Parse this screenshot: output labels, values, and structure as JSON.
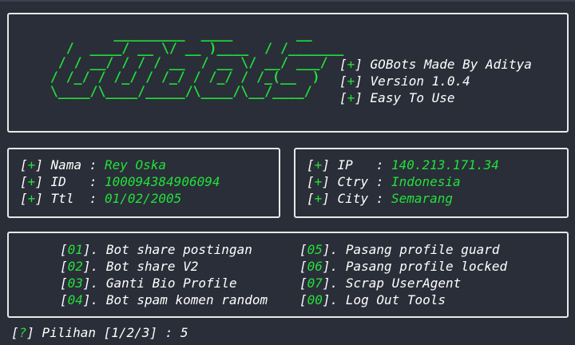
{
  "banner": {
    "ascii_logo": [
      "          _________  ____        __",
      "    /  ____/ __ \\/ __ )____  / /_______",
      "   / / __/ / / / __  / __ \\/ __/ ___/",
      "  / /_/ / /_/ / /_/ / /_/ / /_(__  )",
      "  \\____/\\____/_____/\\____/\\__/____/"
    ],
    "logo_alt": "GOBots",
    "info": [
      {
        "marker": "+",
        "text": "GOBots Made By Aditya"
      },
      {
        "marker": "+",
        "text": "Version 1.0.4"
      },
      {
        "marker": "+",
        "text": "Easy To Use"
      }
    ]
  },
  "user": [
    {
      "marker": "+",
      "label": "Nama",
      "sep": " : ",
      "value": "Rey Oska"
    },
    {
      "marker": "+",
      "label": "ID  ",
      "sep": " : ",
      "value": "100094384906094"
    },
    {
      "marker": "+",
      "label": "Ttl ",
      "sep": " : ",
      "value": "01/02/2005"
    }
  ],
  "network": [
    {
      "marker": "+",
      "label": "IP  ",
      "sep": " : ",
      "value": "140.213.171.34"
    },
    {
      "marker": "+",
      "label": "Ctry",
      "sep": " : ",
      "value": "Indonesia"
    },
    {
      "marker": "+",
      "label": "City",
      "sep": " : ",
      "value": "Semarang"
    }
  ],
  "menu": {
    "left": [
      {
        "num": "01",
        "label": "Bot share postingan"
      },
      {
        "num": "02",
        "label": "Bot share V2"
      },
      {
        "num": "03",
        "label": "Ganti Bio Profile"
      },
      {
        "num": "04",
        "label": "Bot spam komen random"
      }
    ],
    "right": [
      {
        "num": "05",
        "label": "Pasang profile guard"
      },
      {
        "num": "06",
        "label": "Pasang profile locked"
      },
      {
        "num": "07",
        "label": "Scrap UserAgent"
      },
      {
        "num": "00",
        "label": "Log Out Tools"
      }
    ]
  },
  "prompt": {
    "marker": "?",
    "text": "Pilihan [1/2/3] : ",
    "input": "5"
  },
  "colors": {
    "accent": "#22e03a",
    "background": "#2a2e38",
    "border": "#e8e8e8",
    "text": "#ffffff"
  }
}
